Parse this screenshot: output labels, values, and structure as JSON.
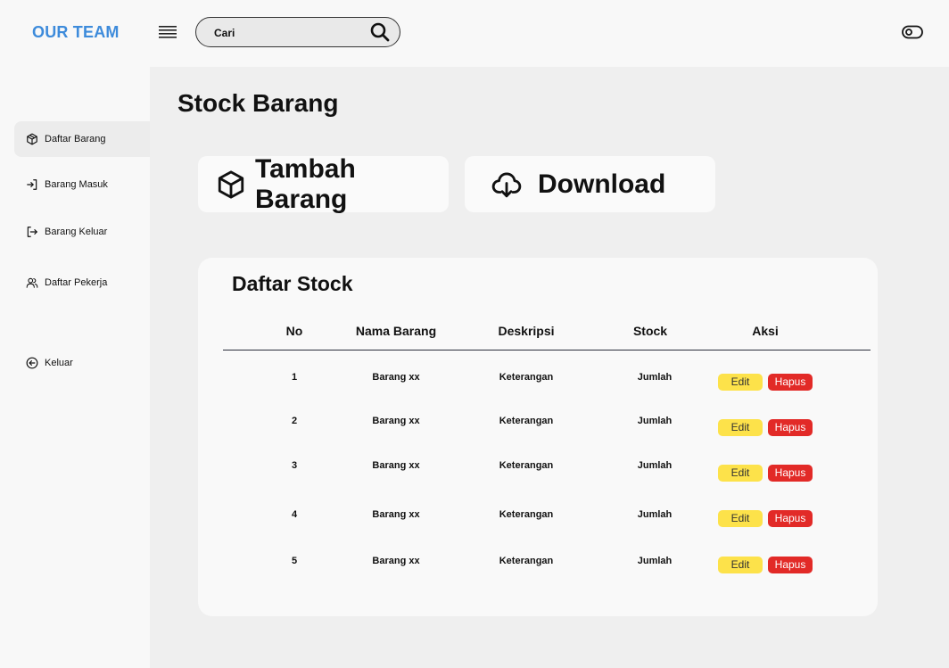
{
  "brand": "OUR TEAM",
  "search": {
    "placeholder": "Cari"
  },
  "sidebar": {
    "items": [
      {
        "label": "Daftar Barang",
        "icon": "box-icon",
        "active": true
      },
      {
        "label": "Barang Masuk",
        "icon": "login-arrow-icon",
        "active": false
      },
      {
        "label": "Barang Keluar",
        "icon": "logout-arrow-icon",
        "active": false
      },
      {
        "label": "Daftar Pekerja",
        "icon": "users-icon",
        "active": false
      },
      {
        "label": "Keluar",
        "icon": "circle-arrow-left-icon",
        "active": false
      }
    ]
  },
  "main": {
    "title": "Stock Barang",
    "actions": {
      "add_label": "Tambah Barang",
      "download_label": "Download"
    }
  },
  "table": {
    "title": "Daftar Stock",
    "columns": [
      "No",
      "Nama Barang",
      "Deskripsi",
      "Stock",
      "Aksi"
    ],
    "rows": [
      {
        "no": "1",
        "nama": "Barang xx",
        "deskripsi": "Keterangan",
        "stock": "Jumlah"
      },
      {
        "no": "2",
        "nama": "Barang xx",
        "deskripsi": "Keterangan",
        "stock": "Jumlah"
      },
      {
        "no": "3",
        "nama": "Barang xx",
        "deskripsi": "Keterangan",
        "stock": "Jumlah"
      },
      {
        "no": "4",
        "nama": "Barang xx",
        "deskripsi": "Keterangan",
        "stock": "Jumlah"
      },
      {
        "no": "5",
        "nama": "Barang xx",
        "deskripsi": "Keterangan",
        "stock": "Jumlah"
      }
    ],
    "edit_label": "Edit",
    "delete_label": "Hapus"
  },
  "colors": {
    "brand": "#3d8bdb",
    "edit": "#fde24a",
    "delete": "#e22a27"
  }
}
